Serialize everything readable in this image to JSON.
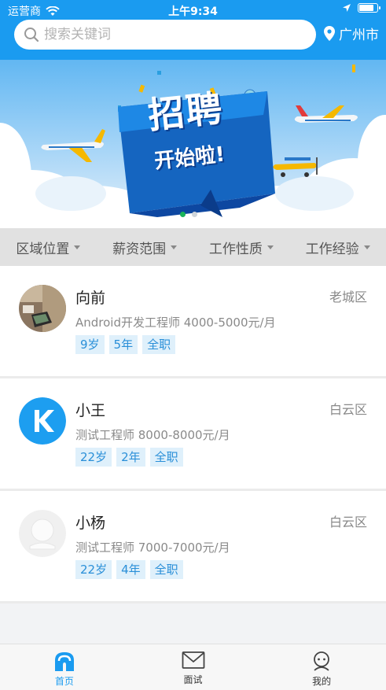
{
  "status_bar": {
    "carrier": "运营商",
    "time": "上午9:34",
    "battery_level": 0.85
  },
  "search": {
    "placeholder": "搜索关键词",
    "icon": "search-icon"
  },
  "location": {
    "city": "广州市",
    "icon": "location-pin-icon"
  },
  "banner": {
    "headline": "招聘",
    "subline": "开始啦!",
    "active_slide": 1,
    "slide_count": 2
  },
  "filters": [
    {
      "label": "区域位置"
    },
    {
      "label": "薪资范围"
    },
    {
      "label": "工作性质"
    },
    {
      "label": "工作经验"
    }
  ],
  "candidates": [
    {
      "name": "向前",
      "district": "老城区",
      "description": "Android开发工程师 4000-5000元/月",
      "tags": [
        "9岁",
        "5年",
        "全职"
      ],
      "avatar": "photo-avatar"
    },
    {
      "name": "小王",
      "district": "白云区",
      "description": "测试工程师 8000-8000元/月",
      "tags": [
        "22岁",
        "2年",
        "全职"
      ],
      "avatar": "k-logo-avatar"
    },
    {
      "name": "小杨",
      "district": "白云区",
      "description": "测试工程师 7000-7000元/月",
      "tags": [
        "22岁",
        "4年",
        "全职"
      ],
      "avatar": "default-avatar"
    }
  ],
  "tabbar": [
    {
      "label": "首页",
      "icon": "home-icon",
      "active": true
    },
    {
      "label": "面试",
      "icon": "mail-icon",
      "active": false
    },
    {
      "label": "我的",
      "icon": "profile-icon",
      "active": false
    }
  ],
  "colors": {
    "primary": "#1a9bf0",
    "tag_bg": "#dff0fb",
    "tag_text": "#2a8fd8"
  }
}
